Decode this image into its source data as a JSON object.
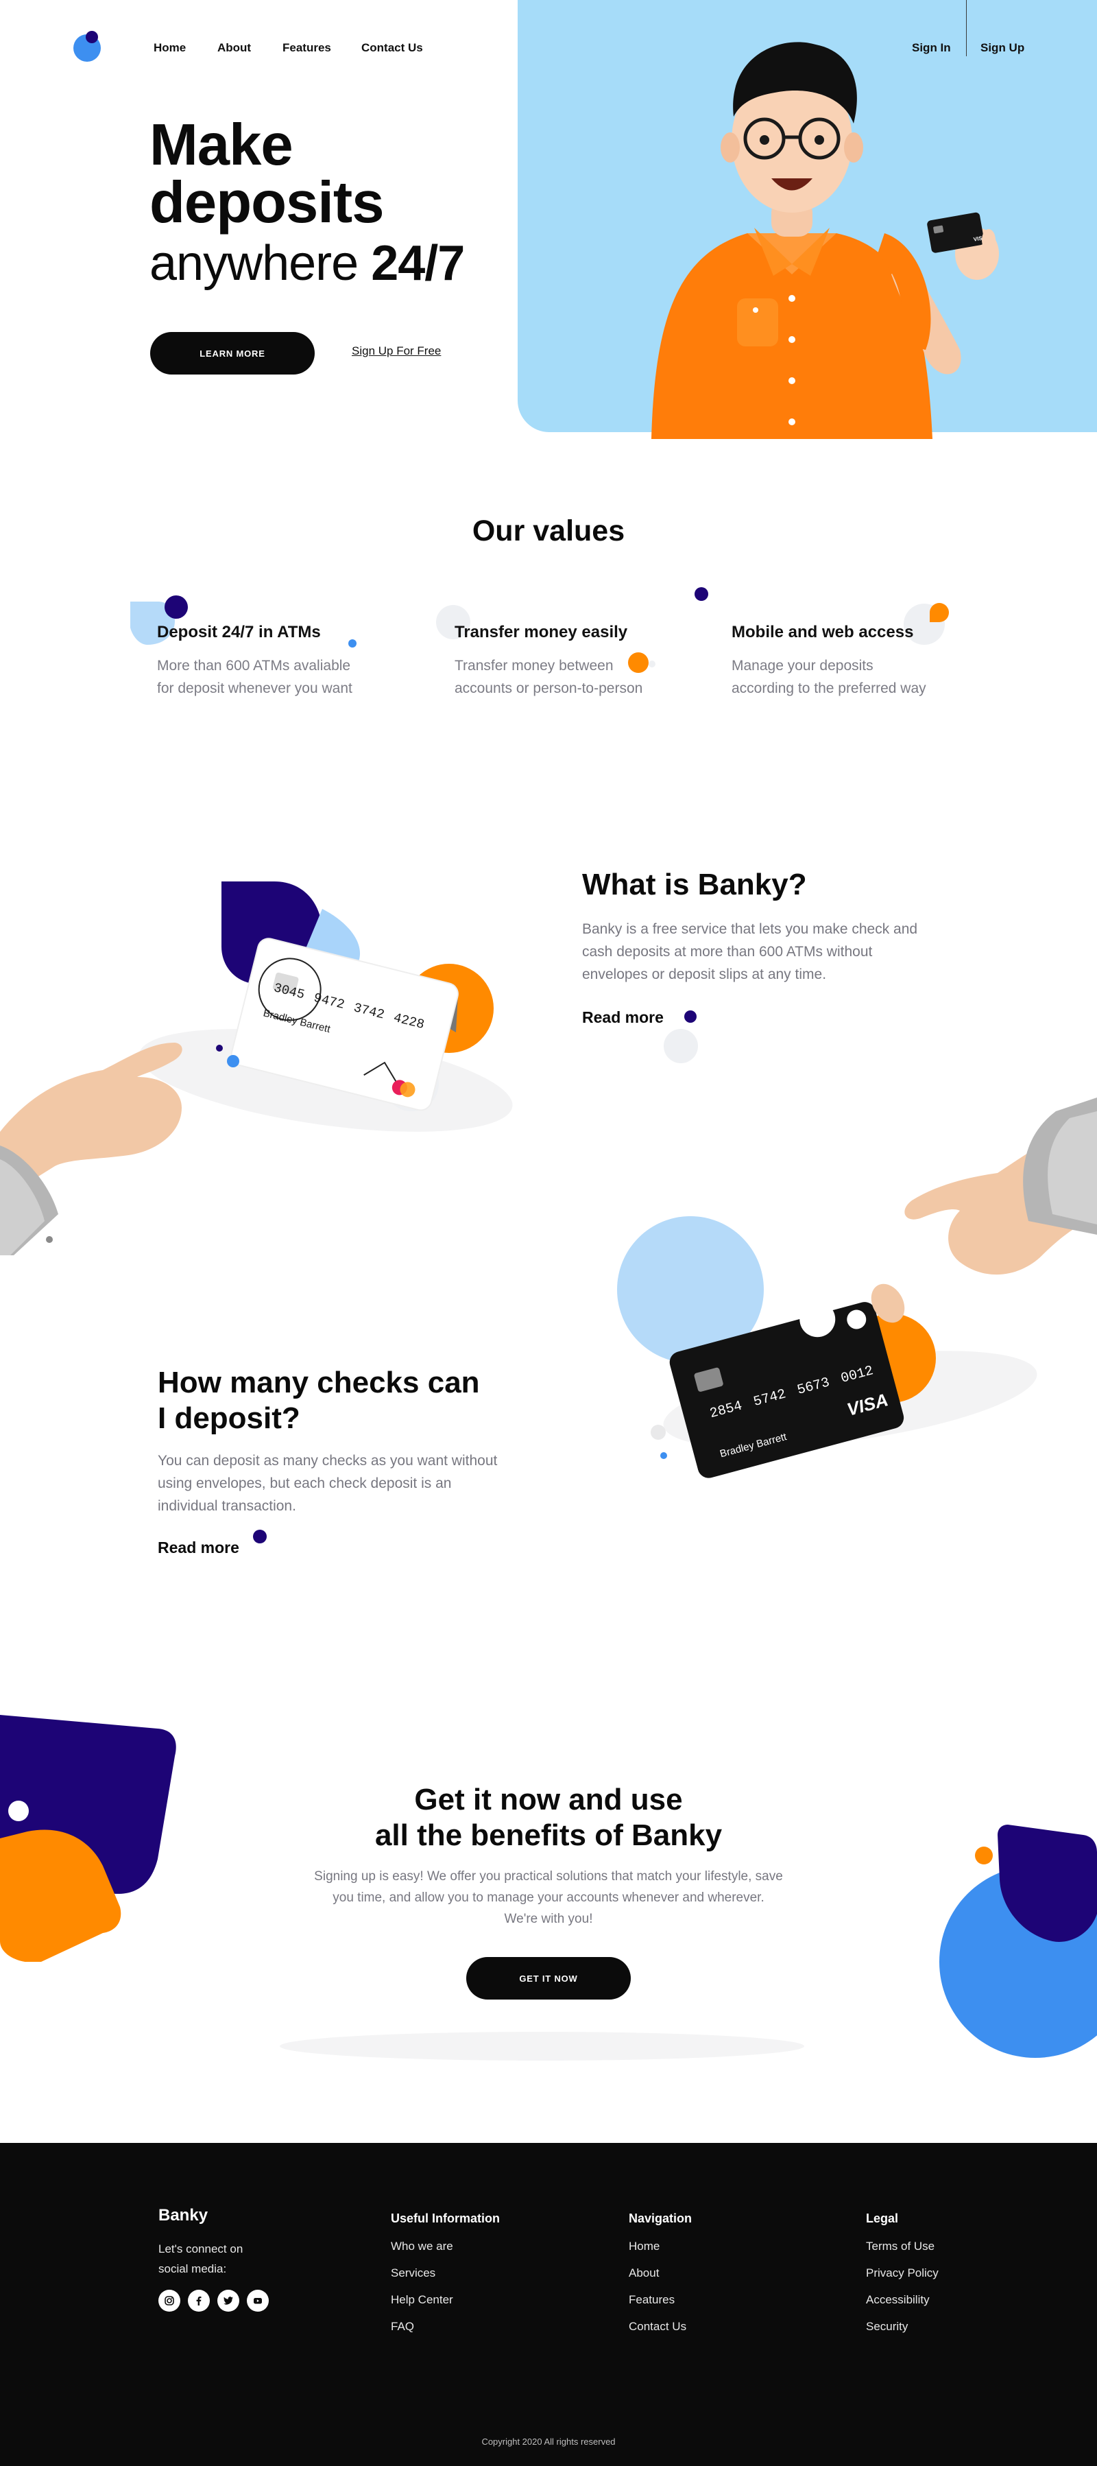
{
  "nav": {
    "items": [
      {
        "label": "Home"
      },
      {
        "label": "About"
      },
      {
        "label": "Features"
      },
      {
        "label": "Contact Us"
      }
    ],
    "sign_in": "Sign In",
    "sign_up": "Sign Up"
  },
  "hero": {
    "title_line1": "Make",
    "title_line2": "deposits",
    "title_line3_light": "anywhere",
    "title_line3_bold": "24/7",
    "cta_primary": "LEARN MORE",
    "cta_secondary": "Sign Up For Free"
  },
  "values": {
    "title": "Our values",
    "items": [
      {
        "title": "Deposit 24/7 in ATMs",
        "desc_line1": "More than 600 ATMs avaliable",
        "desc_line2": "for deposit whenever you want"
      },
      {
        "title": "Transfer money easily",
        "desc_line1": "Transfer money between",
        "desc_line2": "accounts or person-to-person"
      },
      {
        "title": "Mobile and web access",
        "desc_line1": "Manage your deposits",
        "desc_line2": "according to the preferred way"
      }
    ]
  },
  "what_is": {
    "title": "What is Banky?",
    "body_line1": "Banky is a free service that lets you make check and",
    "body_line2": "cash deposits at more than 600 ATMs without",
    "body_line3": "envelopes or deposit slips at any time.",
    "read_more": "Read more"
  },
  "card1": {
    "number": [
      "3045",
      "9472",
      "3742",
      "4228"
    ],
    "name": "Bradley Barrett"
  },
  "how_many": {
    "title_line1": "How many checks can",
    "title_line2": "I deposit?",
    "body_line1": "You can deposit as many checks as you want without",
    "body_line2": "using envelopes, but each check deposit is an",
    "body_line3": "individual transaction.",
    "read_more": "Read more"
  },
  "card2": {
    "number": [
      "2854",
      "5742",
      "5673",
      "0012"
    ],
    "name": "Bradley Barrett",
    "brand": "VISA"
  },
  "cta": {
    "title_line1": "Get it now and use",
    "title_line2": "all the benefits of Banky",
    "body_line1": "Signing up is easy! We offer you practical solutions that match your lifestyle, save",
    "body_line2": "you time, and allow you to manage your accounts whenever and wherever.",
    "body_line3": "We're with you!",
    "button": "GET IT NOW"
  },
  "footer": {
    "brand": "Banky",
    "connect_line1": "Let's connect on",
    "connect_line2": "social media:",
    "social_icons": [
      "instagram-icon",
      "facebook-icon",
      "twitter-icon",
      "youtube-icon"
    ],
    "columns": [
      {
        "heading": "Useful Information",
        "items": [
          "Who we are",
          "Services",
          "Help Center",
          "FAQ"
        ]
      },
      {
        "heading": "Navigation",
        "items": [
          "Home",
          "About",
          "Features",
          "Contact Us"
        ]
      },
      {
        "heading": "Legal",
        "items": [
          "Terms of Use",
          "Privacy Policy",
          "Accessibility",
          "Security"
        ]
      }
    ],
    "copyright": "Copyright 2020 All rights reserved"
  },
  "colors": {
    "accent_blue": "#3d8ff0",
    "navy": "#1d0476",
    "orange": "#ff8a00",
    "light_blue": "#a6dcf9",
    "black": "#0b0b0b"
  }
}
